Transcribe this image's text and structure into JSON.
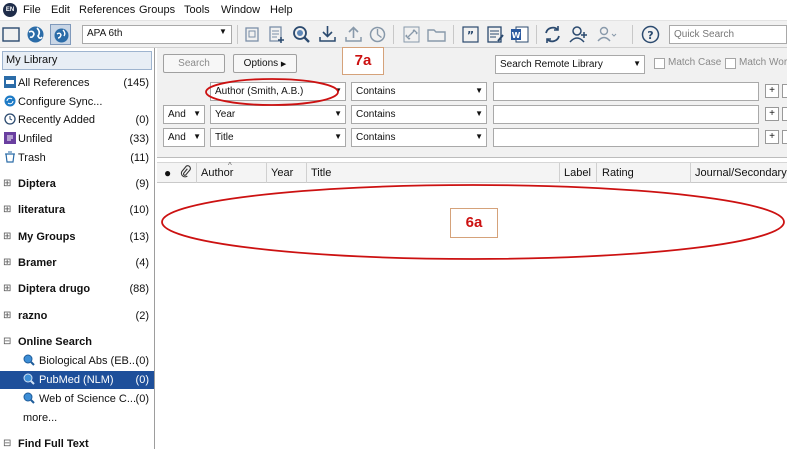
{
  "menubar": {
    "items": [
      "File",
      "Edit",
      "References",
      "Groups",
      "Tools",
      "Window",
      "Help"
    ]
  },
  "toolbar": {
    "style_value": "APA 6th",
    "quick_search_placeholder": "Quick Search",
    "icons": [
      "local-library-icon",
      "online-search-icon",
      "integrated-library-icon",
      "copy-folder-icon",
      "new-reference-icon",
      "online-find-icon",
      "import-icon",
      "export-icon",
      "find-full-text-icon",
      "link-icon",
      "open-file-icon",
      "insert-citation-icon",
      "edit-reference-icon",
      "word-icon",
      "sync-icon",
      "share-icon",
      "add-user-icon",
      "help-icon"
    ]
  },
  "sidebar": {
    "header": "My Library",
    "items": [
      {
        "label": "All References",
        "count": "(145)"
      },
      {
        "label": "Configure Sync...",
        "count": ""
      },
      {
        "label": "Recently Added",
        "count": "(0)"
      },
      {
        "label": "Unfiled",
        "count": "(33)"
      },
      {
        "label": "Trash",
        "count": "(11)"
      }
    ],
    "groups": [
      {
        "label": "Diptera",
        "count": "(9)"
      },
      {
        "label": "literatura",
        "count": "(10)"
      },
      {
        "label": "My Groups",
        "count": "(13)"
      },
      {
        "label": "Bramer",
        "count": "(4)"
      },
      {
        "label": "Diptera drugo",
        "count": "(88)"
      },
      {
        "label": "razno",
        "count": "(2)"
      }
    ],
    "online_search": {
      "label": "Online Search",
      "items": [
        {
          "label": "Biological Abs (EB...",
          "count": "(0)"
        },
        {
          "label": "PubMed (NLM)",
          "count": "(0)"
        },
        {
          "label": "Web of Science C...",
          "count": "(0)"
        }
      ],
      "more": "more..."
    },
    "find_full_text": "Find Full Text"
  },
  "search": {
    "search_button": "Search",
    "options_button": "Options",
    "remote_select": "Search Remote Library",
    "match_case": "Match Case",
    "match_words": "Match Words",
    "rows": [
      {
        "bool": "",
        "field": "Author (Smith, A.B.)",
        "op": "Contains"
      },
      {
        "bool": "And",
        "field": "Year",
        "op": "Contains"
      },
      {
        "bool": "And",
        "field": "Title",
        "op": "Contains"
      }
    ]
  },
  "columns": {
    "author": "Author",
    "year": "Year",
    "title": "Title",
    "label": "Label",
    "rating": "Rating",
    "journal": "Journal/Secondary ..."
  },
  "annotations": {
    "label_7a": "7a",
    "label_6a": "6a",
    "color": "#cc1111"
  }
}
